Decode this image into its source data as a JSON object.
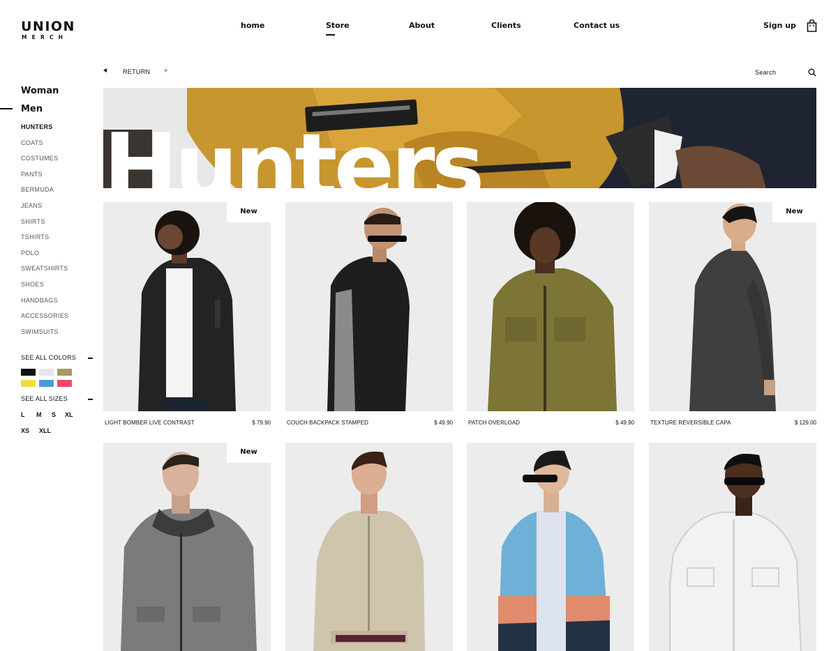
{
  "brand": {
    "main": "UNION",
    "sub": "MERCH"
  },
  "nav": {
    "home": "home",
    "store": "Store",
    "about": "About",
    "clients": "Clients",
    "contact": "Contact us"
  },
  "account": {
    "signup": "Sign up"
  },
  "sidebar": {
    "woman": "Woman",
    "men": "Men",
    "items": [
      "HUNTERS",
      "COATS",
      "COSTUMES",
      "PANTS",
      "BERMUDA",
      "JEANS",
      "SHIRTS",
      "TSHIRTS",
      "POLO",
      "SWEATSHIRTS",
      "SHOES",
      "HANDBAGS",
      "ACCESSORIES",
      "SWIMSUITS"
    ],
    "colors_label": "SEE ALL COLORS",
    "colors": [
      "#111111",
      "#e6e6e6",
      "#a69b63",
      "#ecdf3b",
      "#4a9bd0",
      "#f24569"
    ],
    "sizes_label": "SEE ALL SIZES",
    "sizes_row1": [
      "L",
      "M",
      "S",
      "XL"
    ],
    "sizes_row2": [
      "XS",
      "XLL"
    ]
  },
  "toolbar": {
    "return_label": "RETURN",
    "search_label": "Search"
  },
  "banner": {
    "title": "Hunters"
  },
  "products": [
    {
      "name": "LIGHT BOMBER LIVE CONTRAST",
      "price": "$ 79.90",
      "badge": "New"
    },
    {
      "name": "COUCH BACKPACK STAMPED",
      "price": "$ 49.90",
      "badge": ""
    },
    {
      "name": "PATCH OVERLOAD",
      "price": "$ 49.90",
      "badge": ""
    },
    {
      "name": "TEXTURE REVERSIBLE CAPA",
      "price": "$ 129.00",
      "badge": "New"
    },
    {
      "name": "",
      "price": "",
      "badge": "New"
    },
    {
      "name": "",
      "price": "",
      "badge": ""
    },
    {
      "name": "",
      "price": "",
      "badge": ""
    },
    {
      "name": "",
      "price": "",
      "badge": ""
    }
  ]
}
